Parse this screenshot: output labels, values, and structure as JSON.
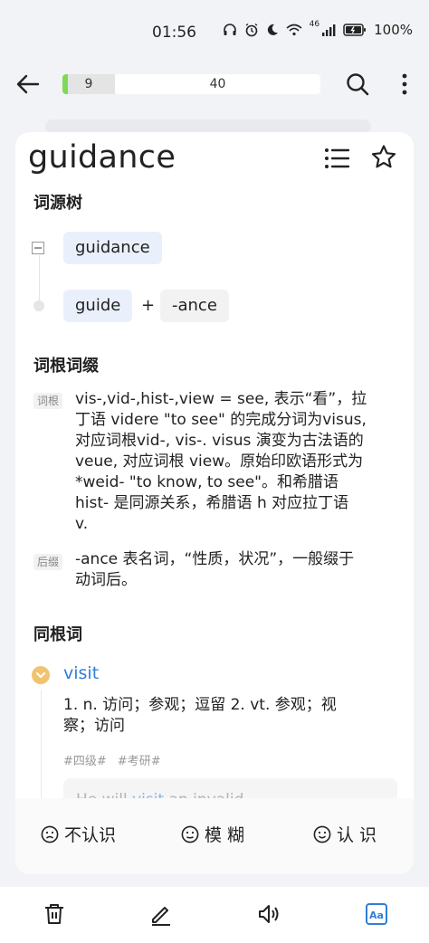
{
  "status_bar": {
    "time": "01:56",
    "network": "46",
    "battery": "100%"
  },
  "top_bar": {
    "progress_done": "9",
    "progress_total": "40",
    "progress_fraction": 0.1
  },
  "word": {
    "title": "guidance"
  },
  "etymology_tree": {
    "title": "词源树",
    "root_chip": "guidance",
    "parts": [
      "guide",
      "+",
      "-ance"
    ]
  },
  "roots_affixes": {
    "title": "词根词缀",
    "items": [
      {
        "tag": "词根",
        "lines": [
          "vis-,vid-,hist-,view = see, 表示“看”，拉",
          "丁语 videre \"to see\" 的完成分词为visus,",
          "对应词根vid-, vis-. visus 演变为古法语的",
          "veue, 对应词根 view。原始印欧语形式为",
          "*weid- \"to know, to see\"。和希腊语",
          "hist- 是同源关系，希腊语 h 对应拉丁语",
          "v."
        ]
      },
      {
        "tag": "后缀",
        "lines": [
          "-ance 表名词，“性质，状况”，一般缀于",
          "动词后。"
        ]
      }
    ]
  },
  "cognates": {
    "title": "同根词",
    "items": [
      {
        "word": "visit",
        "def_lines": [
          "1. n. 访问；参观；逗留 2. vt. 参观；视",
          "察；访问"
        ],
        "tags": [
          "#四级#",
          "#考研#"
        ],
        "example_pre": "He will ",
        "example_hl": "visit",
        "example_post": " an invalid"
      }
    ]
  },
  "actions": {
    "unknown": "不认识",
    "vague": "模 糊",
    "known": "认 识"
  },
  "colors": {
    "accent": "#2f7fd6",
    "progress_start": "#7ed957",
    "cognate_icon": "#f0c46e",
    "dictionary_active": "#2f7fd6"
  },
  "icons": [
    "back-arrow-icon",
    "search-icon",
    "more-icon",
    "list-icon",
    "star-icon",
    "minus-box-icon",
    "chevron-down-icon",
    "frown-face-icon",
    "neutral-face-icon",
    "smile-face-icon",
    "trash-icon",
    "pencil-icon",
    "speaker-icon",
    "dictionary-icon"
  ]
}
